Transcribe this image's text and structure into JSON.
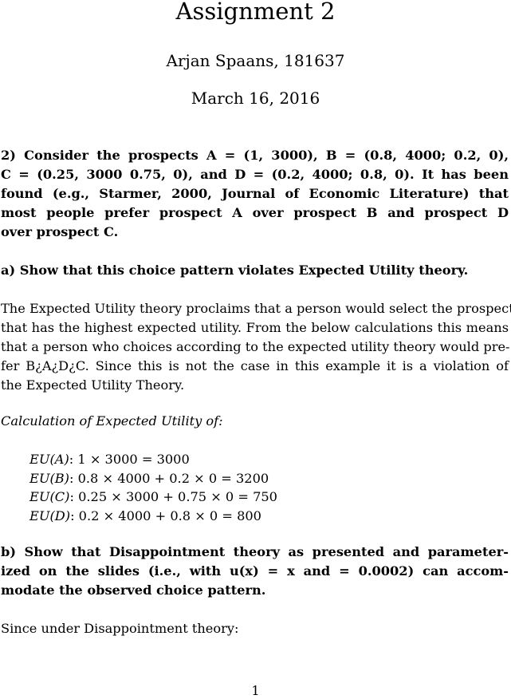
{
  "header": {
    "title": "Assignment 2",
    "author": "Arjan Spaans, 181637",
    "date": "March 16, 2016"
  },
  "question2": {
    "lines": [
      "2) Consider the prospects A = (1, 3000), B = (0.8, 4000; 0.2, 0),",
      "C = (0.25, 3000 0.75, 0), and D = (0.2, 4000; 0.8, 0). It has been",
      "found (e.g., Starmer, 2000, Journal of Economic Literature) that",
      "most people prefer prospect A over prospect B and prospect D",
      "over prospect C."
    ]
  },
  "part_a": {
    "heading": "a) Show that this choice pattern violates Expected Utility theory.",
    "paragraph_lines": [
      "The Expected Utility theory proclaims that a person would select the prospect",
      "that has the highest expected utility. From the below calculations this means",
      "that a person who choices according to the expected utility theory would pre-",
      "fer B¿A¿D¿C. Since this is not the case in this example it is a violation of",
      "the Expected Utility Theory."
    ],
    "calc_heading": "Calculation of Expected Utility of:",
    "calculations": [
      {
        "label": "EU(A)",
        "expression": ": 1 × 3000 = 3000"
      },
      {
        "label": "EU(B)",
        "expression": ": 0.8 × 4000 + 0.2 × 0 = 3200"
      },
      {
        "label": "EU(C)",
        "expression": ": 0.25 × 3000 + 0.75 × 0 = 750"
      },
      {
        "label": "EU(D)",
        "expression": ": 0.2 × 4000 + 0.8 × 0 = 800"
      }
    ]
  },
  "part_b": {
    "heading_lines": [
      "b) Show that Disappointment theory as presented and parameter-",
      "ized on the slides (i.e., with u(x) = x and  = 0.0002) can accom-",
      "modate the observed choice pattern."
    ],
    "paragraph": "Since under Disappointment theory:"
  },
  "footer": {
    "page_number": "1"
  }
}
